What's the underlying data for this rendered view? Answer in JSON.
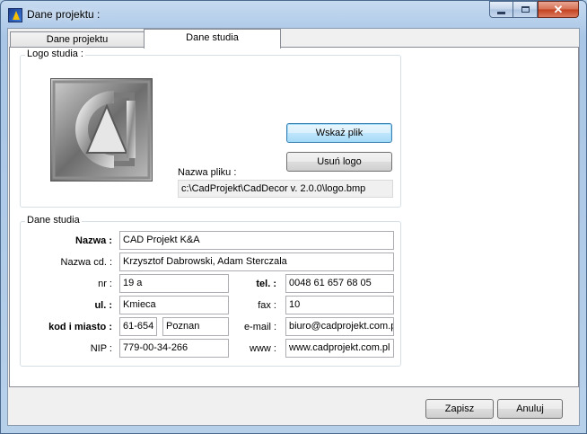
{
  "window": {
    "title": "Dane projektu :"
  },
  "tabs": [
    {
      "label": "Dane projektu"
    },
    {
      "label": "Dane studia"
    }
  ],
  "logo_group": {
    "label": "Logo studia :",
    "browse_button": "Wskaż plik",
    "remove_button": "Usuń logo",
    "filename_label": "Nazwa pliku :",
    "filename_value": "c:\\CadProjekt\\CadDecor v. 2.0.0\\logo.bmp"
  },
  "studio_group": {
    "label": "Dane studia",
    "name_label": "Nazwa :",
    "name_value": "CAD Projekt K&A",
    "name_cont_label": "Nazwa cd. :",
    "name_cont_value": "Krzysztof Dabrowski, Adam Sterczala",
    "nr_label": "nr :",
    "nr_value": "19 a",
    "tel_label": "tel. :",
    "tel_value": "0048 61 657 68 05",
    "street_label": "ul. :",
    "street_value": "Kmieca",
    "fax_label": "fax :",
    "fax_value": "10",
    "city_label": "kod i miasto :",
    "postcode_value": "61-654",
    "city_value": "Poznan",
    "email_label": "e-mail :",
    "email_value": "biuro@cadprojekt.com.pl",
    "nip_label": "NIP :",
    "nip_value": "779-00-34-266",
    "www_label": "www :",
    "www_value": "www.cadprojekt.com.pl"
  },
  "footer": {
    "save": "Zapisz",
    "cancel": "Anuluj"
  },
  "icons": {
    "app": "app-icon",
    "minimize": "minimize-icon",
    "maximize": "maximize-icon",
    "close": "close-icon",
    "logo": "cad-logo-image"
  }
}
